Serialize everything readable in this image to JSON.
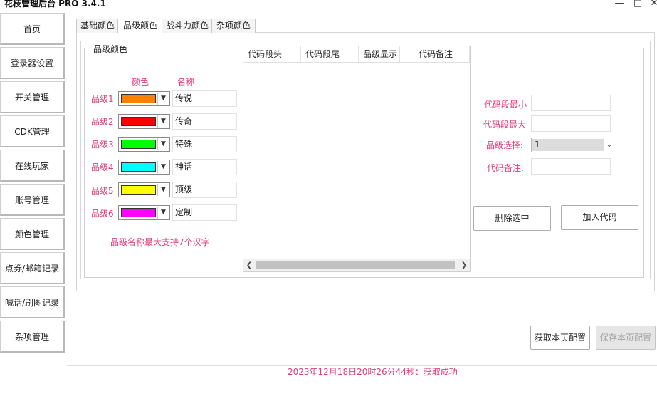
{
  "app": {
    "title": "花枝管理后台 PRO 3.4.1"
  },
  "window_controls": {
    "minimize": "—",
    "maximize": "□",
    "close": "✕"
  },
  "sidebar": {
    "items": [
      {
        "label": "首页"
      },
      {
        "label": "登录器设置"
      },
      {
        "label": "开关管理"
      },
      {
        "label": "CDK管理"
      },
      {
        "label": "在线玩家"
      },
      {
        "label": "账号管理"
      },
      {
        "label": "颜色管理"
      },
      {
        "label": "点券/邮箱记录"
      },
      {
        "label": "喊话/刷图记录"
      },
      {
        "label": "杂项管理"
      }
    ]
  },
  "tabs": [
    {
      "label": "基础颜色"
    },
    {
      "label": "品级颜色",
      "active": true
    },
    {
      "label": "战斗力颜色"
    },
    {
      "label": "杂项颜色"
    }
  ],
  "quality": {
    "group_title": "品级颜色",
    "header_color": "颜色",
    "header_name": "名称",
    "rows": [
      {
        "label": "品级1",
        "color": "#ff7f00",
        "name": "传说"
      },
      {
        "label": "品级2",
        "color": "#ff0000",
        "name": "传奇"
      },
      {
        "label": "品级3",
        "color": "#00ff00",
        "name": "特殊"
      },
      {
        "label": "品级4",
        "color": "#00ffff",
        "name": "神话"
      },
      {
        "label": "品级5",
        "color": "#ffff00",
        "name": "顶级"
      },
      {
        "label": "品级6",
        "color": "#ff00ff",
        "name": "定制"
      }
    ],
    "note": "品级名称最大支持7个汉字"
  },
  "code_list": {
    "columns": [
      "代码段头",
      "代码段尾",
      "品级显示",
      "代码备注"
    ]
  },
  "code_form": {
    "min_label": "代码段最小",
    "max_label": "代码段最大",
    "select_label": "品级选择:",
    "select_value": "1",
    "remark_label": "代码备注:",
    "delete_button": "删除选中",
    "add_button": "加入代码"
  },
  "footer": {
    "fetch_button": "获取本页配置",
    "save_button": "保存本页配置",
    "status": "2023年12月18日20时26分44秒：获取成功"
  }
}
